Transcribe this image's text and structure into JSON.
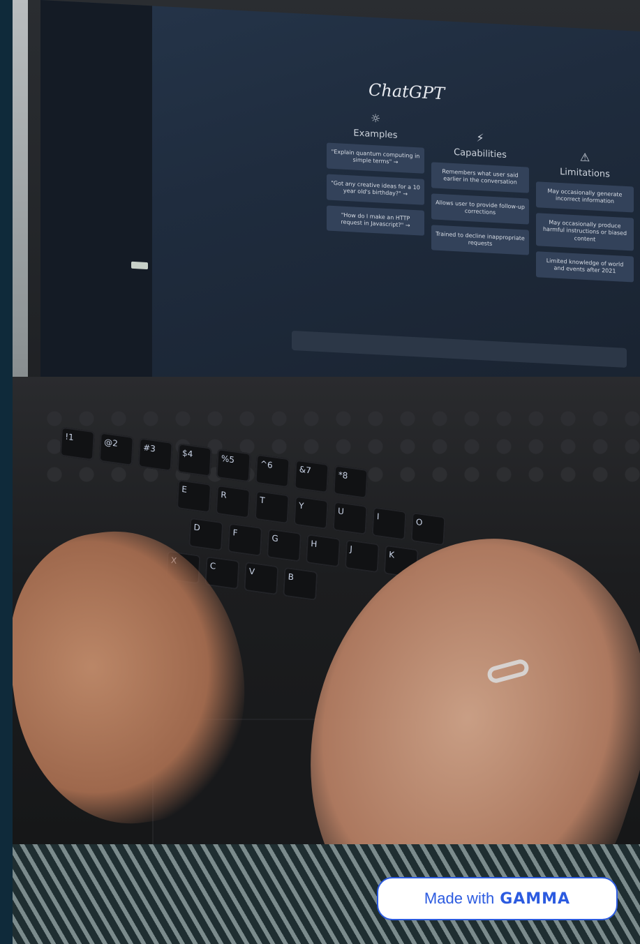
{
  "screen": {
    "title": "ChatGPT",
    "columns": [
      {
        "icon": "sun-icon",
        "heading": "Examples",
        "items": [
          "\"Explain quantum computing in simple terms\" →",
          "\"Got any creative ideas for a 10 year old's birthday?\" →",
          "\"How do I make an HTTP request in Javascript?\" →"
        ]
      },
      {
        "icon": "lightning-icon",
        "heading": "Capabilities",
        "items": [
          "Remembers what user said earlier in the conversation",
          "Allows user to provide follow-up corrections",
          "Trained to decline inappropriate requests"
        ]
      },
      {
        "icon": "warning-icon",
        "heading": "Limitations",
        "items": [
          "May occasionally generate incorrect information",
          "May occasionally produce harmful instructions or biased content",
          "Limited knowledge of world and events after 2021"
        ]
      }
    ]
  },
  "keyboard": {
    "row1": [
      "!1",
      "@2",
      "#3",
      "$4",
      "%5",
      "^6",
      "&7",
      "*8"
    ],
    "row2": [
      "E",
      "R",
      "T",
      "Y",
      "U",
      "I",
      "O"
    ],
    "row3": [
      "D",
      "F",
      "G",
      "H",
      "J",
      "K"
    ],
    "row4": [
      "X",
      "C",
      "V",
      "B"
    ]
  },
  "badge": {
    "prefix": "Made with",
    "brand": "GAMMA"
  }
}
